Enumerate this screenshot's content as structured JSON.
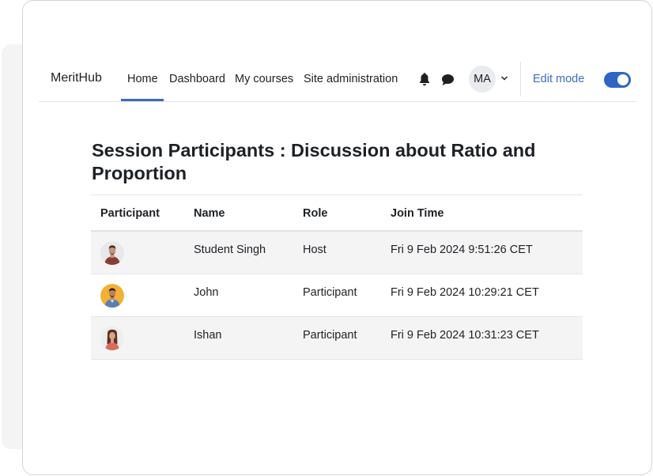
{
  "navbar": {
    "brand": "MeritHub",
    "links": [
      {
        "label": "Home",
        "active": true
      },
      {
        "label": "Dashboard"
      },
      {
        "label": "My courses"
      },
      {
        "label": "Site administration"
      }
    ],
    "icons": [
      "bell-icon",
      "chat-icon",
      "chevron-down-icon"
    ],
    "user_initials": "MA",
    "edit_mode_label": "Edit mode",
    "edit_mode_on": true
  },
  "page": {
    "title": "Session Participants : Discussion about Ratio and Proportion"
  },
  "table": {
    "headers": [
      "Participant",
      "Name",
      "Role",
      "Join Time"
    ],
    "rows": [
      {
        "name": "Student Singh",
        "role": "Host",
        "join_time": "Fri 9 Feb 2024 9:51:26 CET"
      },
      {
        "name": "John",
        "role": "Participant",
        "join_time": "Fri 9 Feb 2024 10:29:21 CET"
      },
      {
        "name": "Ishan",
        "role": "Participant",
        "join_time": "Fri 9 Feb 2024 10:31:23 CET"
      }
    ]
  },
  "colors": {
    "accent": "#3b6dbd",
    "toggle_on": "#2f66c4",
    "stripe": "#f4f4f5"
  }
}
